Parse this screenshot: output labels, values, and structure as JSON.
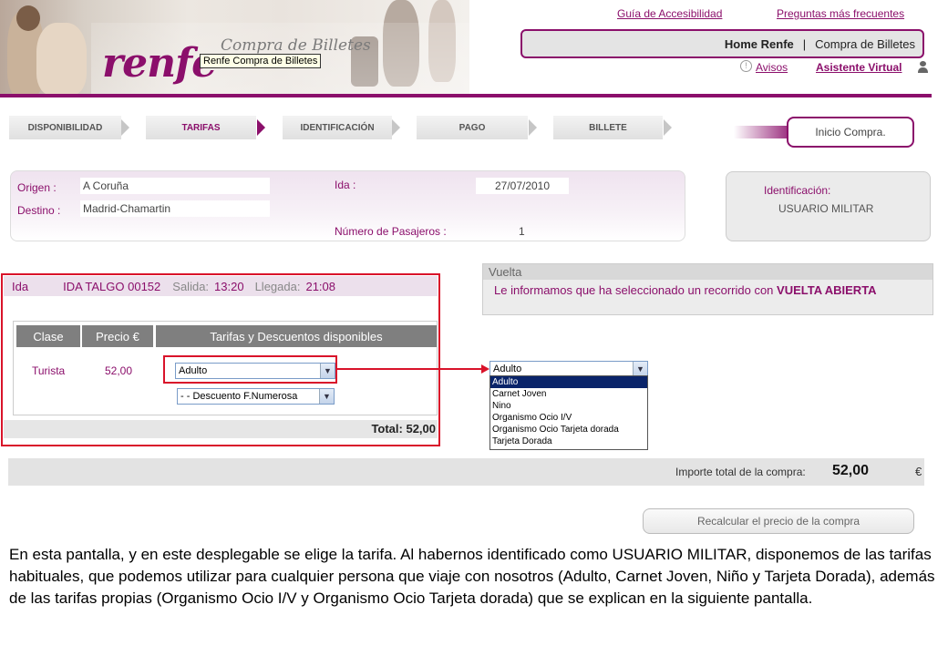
{
  "header": {
    "logo": "renfe",
    "subtitle": "Compra de Billetes",
    "tooltip": "Renfe Compra de Billetes",
    "links": {
      "accesibilidad": "Guía de Accesibilidad",
      "faq": "Preguntas más frecuentes",
      "avisos": "Avisos",
      "asistente": "Asistente Virtual"
    },
    "nav": {
      "home": "Home Renfe",
      "separator": "|",
      "compra": "Compra de Billetes"
    }
  },
  "steps": [
    "DISPONIBILIDAD",
    "TARIFAS",
    "IDENTIFICACIÓN",
    "PAGO",
    "BILLETE"
  ],
  "active_step": "TARIFAS",
  "inicio_compra": "Inicio Compra.",
  "summary": {
    "origen_label": "Origen :",
    "origen": "A Coruña",
    "destino_label": "Destino :",
    "destino": "Madrid-Chamartin",
    "ida_label": "Ida :",
    "ida_date": "27/07/2010",
    "pasajeros_label": "Número de Pasajeros :",
    "pasajeros": "1"
  },
  "identificacion": {
    "label": "Identificación:",
    "value": "USUARIO MILITAR"
  },
  "ida": {
    "label": "Ida",
    "train": "IDA TALGO 00152",
    "salida_label": "Salida:",
    "salida": "13:20",
    "llegada_label": "Llegada:",
    "llegada": "21:08",
    "columns": [
      "Clase",
      "Precio €",
      "Tarifas y Descuentos disponibles"
    ],
    "row": {
      "clase": "Turista",
      "precio": "52,00"
    },
    "tarifa_selected": "Adulto",
    "descuento_selected": "- - Descuento F.Numerosa",
    "total": "Total: 52,00"
  },
  "dropdown": {
    "selected": "Adulto",
    "options": [
      "Adulto",
      "Carnet Joven",
      "Nino",
      "Organismo Ocio I/V",
      "Organismo Ocio Tarjeta dorada",
      "Tarjeta Dorada"
    ]
  },
  "vuelta": {
    "label": "Vuelta",
    "message": "Le informamos que ha seleccionado un recorrido con",
    "message_bold": "VUELTA ABIERTA"
  },
  "importe": {
    "label": "Importe total de la compra:",
    "value": "52,00",
    "currency": "€"
  },
  "recalcular": "Recalcular el precio de la compra",
  "caption": "En esta pantalla, y en este desplegable se elige la tarifa. Al habernos identificado como USUARIO MILITAR, disponemos de las tarifas habituales, que podemos utilizar para cualquier persona que viaje con nosotros (Adulto, Carnet Joven, Niño y Tarjeta Dorada), además de las tarifas propias (Organismo Ocio I/V y Organismo Ocio Tarjeta dorada) que se explican en la siguiente pantalla.",
  "colors": {
    "brand": "#8b0f6b",
    "highlight": "#d9132a",
    "selection": "#0a246a"
  }
}
